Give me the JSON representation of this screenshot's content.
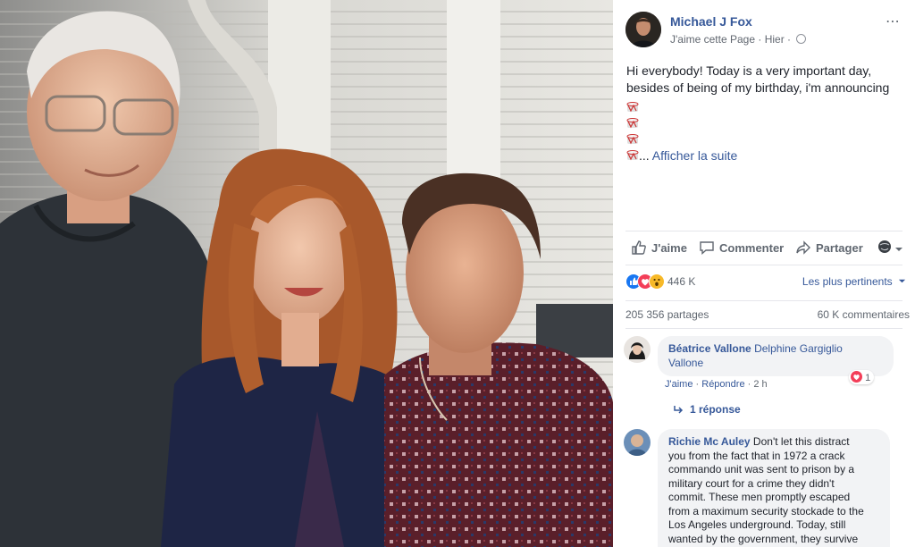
{
  "post": {
    "page_name": "Michael J Fox",
    "liked_page": "J'aime cette Page",
    "separator": " · ",
    "time": "Hier",
    "text_line1": "Hi everybody! Today is a very important day,",
    "text_line2": "besides of being of my birthday, i'm announcing",
    "see_more_prefix": "... ",
    "see_more": "Afficher la suite",
    "more_icon": "⋯",
    "photo_alt": "Three people posing together backstage"
  },
  "actions": {
    "like": "J'aime",
    "comment": "Commenter",
    "share": "Partager"
  },
  "reactions": {
    "count": "446 K",
    "sort_label": "Les plus pertinents",
    "colors": {
      "like": "#1877f2",
      "love": "#f33e58",
      "wow": "#f7b928"
    }
  },
  "stats": {
    "shares": "205 356 partages",
    "comments": "60 K commentaires"
  },
  "comments": [
    {
      "author": "Béatrice Vallone",
      "tagged_line1": "Delphine Gargiglio",
      "tagged_line2": "Vallone",
      "like": "J'aime",
      "reply": "Répondre",
      "time": "2 h",
      "heart_count": "1",
      "replies": "1 réponse"
    },
    {
      "author": "Richie Mc Auley",
      "text_l1": " Don't let this distract",
      "text_l2": "you from the fact that in 1972 a crack",
      "text_l3": "commando unit was sent to prison by a",
      "text_l4": "military court for a crime they didn't",
      "text_l5": "commit. These men promptly escaped",
      "text_l6": "from a maximum security stockade to the",
      "text_l7": "Los Angeles underground. Today, still",
      "text_l8": "wanted by the government, they survive"
    }
  ]
}
